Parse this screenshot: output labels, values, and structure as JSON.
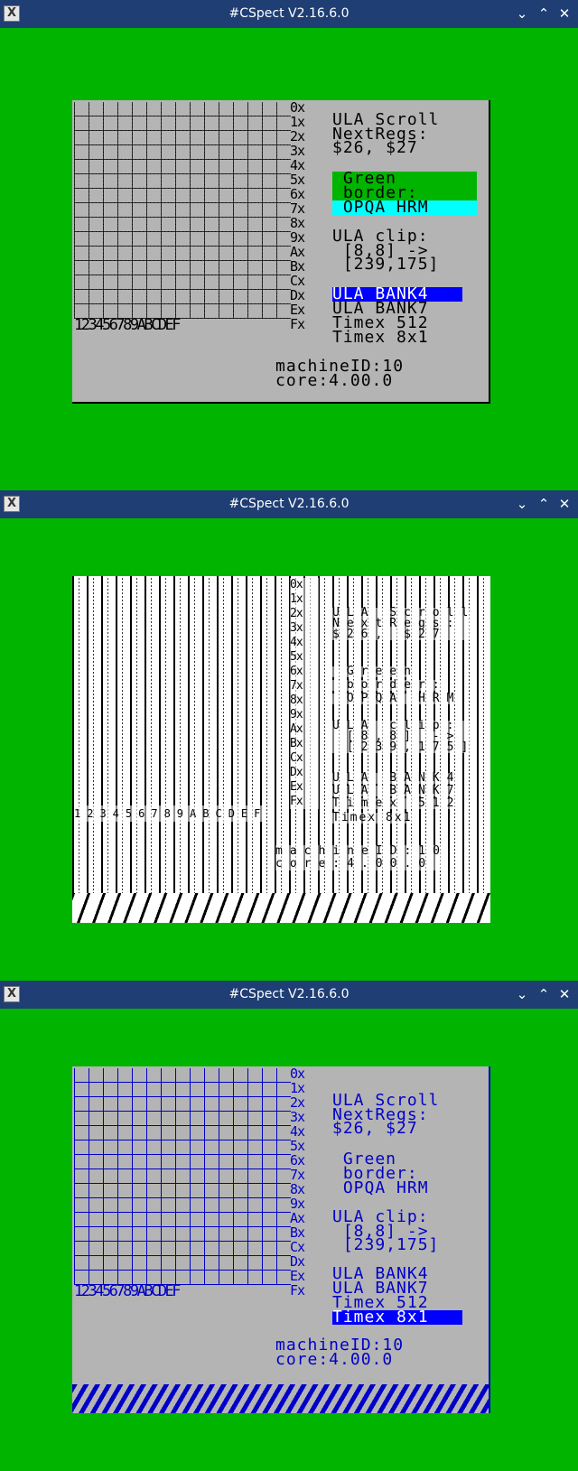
{
  "windows": [
    {
      "title": "#CSpect V2.16.6.0",
      "icon": "x-window-icon",
      "controls": {
        "minimize": "⌄",
        "maximize": "⌃",
        "close": "✕"
      },
      "palette": {
        "border": "#00b400",
        "paper": "#b4b4b4",
        "ink": "#000000"
      },
      "row_labels": [
        "0x",
        "1x",
        "2x",
        "3x",
        "4x",
        "5x",
        "6x",
        "7x",
        "8x",
        "9x",
        "Ax",
        "Bx",
        "Cx",
        "Dx",
        "Ex",
        "Fx"
      ],
      "col_labels": "123456789ABCDEF",
      "info": {
        "scroll": "ULA Scroll\nNextRegs:\n$26, $27",
        "border_line1": " Green",
        "border_line2": " border:",
        "border_line3": " OPQA HRM",
        "clip": "ULA clip:\n [8,8] ->\n [239,175]",
        "bank4": "ULA BANK4",
        "bank7": "ULA BANK7",
        "timex512": "Timex 512",
        "timex8x1": "Timex 8x1",
        "machine": "machineID:10\ncore:4.00.0"
      }
    },
    {
      "title": "#CSpect V2.16.6.0",
      "icon": "x-window-icon",
      "controls": {
        "minimize": "⌄",
        "maximize": "⌃",
        "close": "✕"
      },
      "palette": {
        "border": "#00b400",
        "paper": "#ffffff",
        "ink": "#000000"
      },
      "row_labels": [
        "0x",
        "1x",
        "2x",
        "3x",
        "4x",
        "5x",
        "6x",
        "7x",
        "8x",
        "9x",
        "Ax",
        "Bx",
        "Cx",
        "Dx",
        "Ex",
        "Fx"
      ],
      "col_labels": "123456789ABCDEF",
      "info": {
        "scroll": "ULA Scroll\nNextRegs:\n$26, $27",
        "border_line1": " Green",
        "border_line2": " border:",
        "border_line3": " OPQA HRM",
        "clip": "ULA clip:\n [8,8] ->\n [239,175]",
        "bank4": "ULA BANK4",
        "bank7": "ULA BANK7",
        "timex512": "Timex 512",
        "timex8x1": "Timex 8x1",
        "machine": "machineID:10\ncore:4.00.0"
      }
    },
    {
      "title": "#CSpect V2.16.6.0",
      "icon": "x-window-icon",
      "controls": {
        "minimize": "⌄",
        "maximize": "⌃",
        "close": "✕"
      },
      "palette": {
        "border": "#00b400",
        "paper": "#b4b4b4",
        "ink": "#0000c8"
      },
      "row_labels": [
        "0x",
        "1x",
        "2x",
        "3x",
        "4x",
        "5x",
        "6x",
        "7x",
        "8x",
        "9x",
        "Ax",
        "Bx",
        "Cx",
        "Dx",
        "Ex",
        "Fx"
      ],
      "col_labels": "123456789ABCDEF",
      "info": {
        "scroll": "ULA Scroll\nNextRegs:\n$26, $27",
        "border_line1": " Green",
        "border_line2": " border:",
        "border_line3": " OPQA HRM",
        "clip": "ULA clip:\n [8,8] ->\n [239,175]",
        "bank4": "ULA BANK4",
        "bank7": "ULA BANK7",
        "timex512": "Timex 512",
        "timex8x1": "Timex 8x1",
        "machine": "machineID:10\ncore:4.00.0"
      }
    }
  ]
}
